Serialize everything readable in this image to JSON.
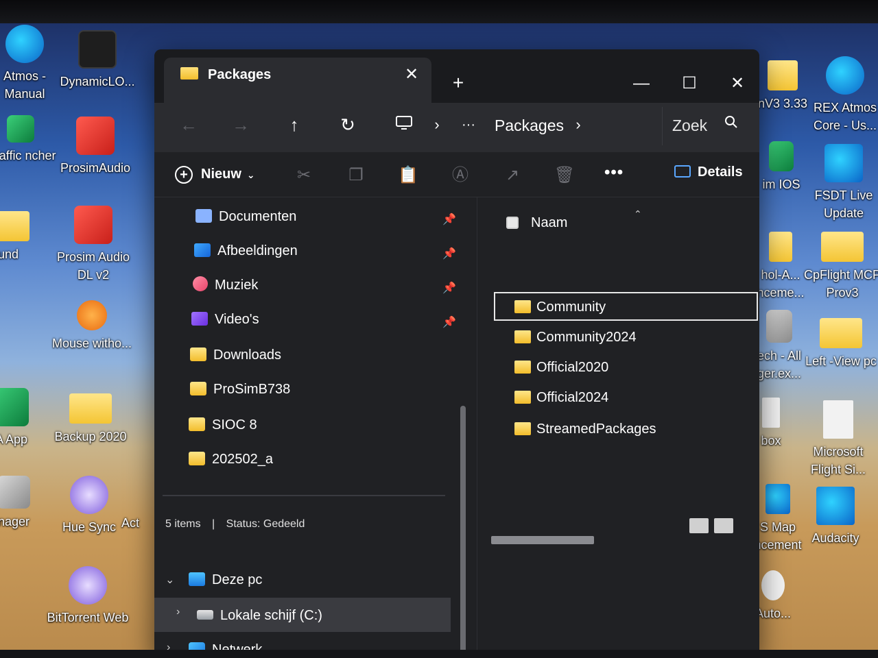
{
  "desktop": {
    "icons_left": [
      {
        "label": "Atmos - Manual",
        "icon": "edge-icon"
      },
      {
        "label": "DynamicLO...",
        "icon": "gauge-icon"
      },
      {
        "label": "lTraffic ncher",
        "icon": "traffic-icon"
      },
      {
        "label": "ProsimAudio",
        "icon": "audio-icon"
      },
      {
        "label": "und",
        "icon": "folder-icon"
      },
      {
        "label": "Prosim Audio DL v2",
        "icon": "audio-icon"
      },
      {
        "label": "Mouse witho...",
        "icon": "mouse-icon"
      },
      {
        "label": "IA App",
        "icon": "nvidia-icon"
      },
      {
        "label": "Backup 2020",
        "icon": "folder-icon"
      },
      {
        "label": "nager",
        "icon": "gear-icon"
      },
      {
        "label": "Hue Sync",
        "icon": "bulb-icon"
      },
      {
        "label": "Act",
        "icon": "app-icon"
      },
      {
        "label": "BitTorrent Web",
        "icon": "bittorrent-icon"
      }
    ],
    "icons_right": [
      {
        "label": "nV3 3.33",
        "icon": "folder-icon"
      },
      {
        "label": "REX Atmos Core - Us...",
        "icon": "edge-icon"
      },
      {
        "label": "im IOS",
        "icon": "app-icon"
      },
      {
        "label": "FSDT Live Update",
        "icon": "fsdt-icon"
      },
      {
        "label": "hol-A... nceme...",
        "icon": "folder-icon"
      },
      {
        "label": "CpFlight MCP Prov3",
        "icon": "folder-icon"
      },
      {
        "label": "ech - All ger.ex...",
        "icon": "installer-icon"
      },
      {
        "label": "Left -View pc",
        "icon": "folder-icon"
      },
      {
        "label": "box",
        "icon": "file-icon"
      },
      {
        "label": "Microsoft Flight Si...",
        "icon": "file-icon"
      },
      {
        "label": "S Map ncement",
        "icon": "installer-icon"
      },
      {
        "label": "Audacity",
        "icon": "audacity-icon"
      },
      {
        "label": "Auto...",
        "icon": "dog-icon"
      }
    ]
  },
  "window": {
    "tab_title": "Packages",
    "tab_close": "✕",
    "new_tab": "+",
    "minimize": "—",
    "maximize": "☐",
    "close": "✕"
  },
  "nav": {
    "back": "←",
    "forward": "→",
    "up": "↑",
    "refresh": "↻",
    "overflow": "···",
    "crumb": "Packages",
    "search_placeholder": "Zoek"
  },
  "command_bar": {
    "new_label": "Nieuw",
    "more": "•••",
    "details_label": "Details"
  },
  "sidebar": {
    "quick_access": [
      {
        "label": "Documenten",
        "pinned": true
      },
      {
        "label": "Afbeeldingen",
        "pinned": true
      },
      {
        "label": "Muziek",
        "pinned": true
      },
      {
        "label": "Video's",
        "pinned": true
      },
      {
        "label": "Downloads",
        "pinned": false
      },
      {
        "label": "ProSimB738",
        "pinned": false
      },
      {
        "label": "SIOC 8",
        "pinned": false
      },
      {
        "label": "202502_a",
        "pinned": false
      }
    ],
    "this_pc": "Deze pc",
    "local_disk": "Lokale schijf (C:)",
    "network": "Netwerk"
  },
  "file_list": {
    "column_name": "Naam",
    "items": [
      "Community",
      "Community2024",
      "Official2020",
      "Official2024",
      "StreamedPackages"
    ],
    "focused_index": 0
  },
  "status_bar": {
    "items_count": "5 items",
    "status": "Status: Gedeeld"
  },
  "colors": {
    "window_bg": "#202124",
    "titlebar_bg": "#1a1b1e",
    "folder_yellow": "#f2bd2c",
    "accent_blue": "#5aa7ff"
  }
}
